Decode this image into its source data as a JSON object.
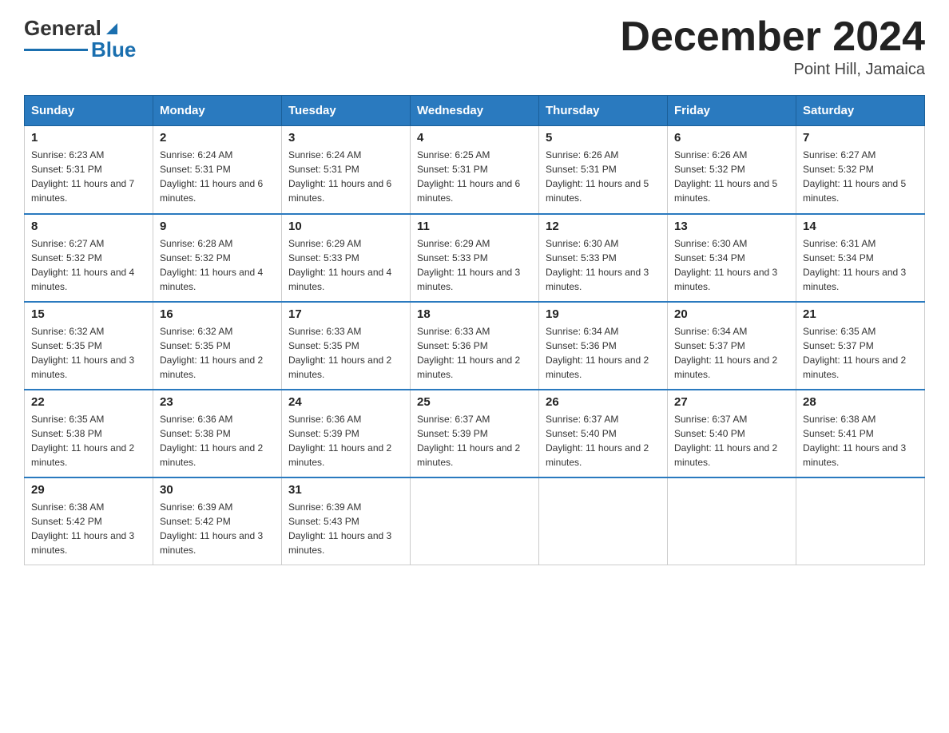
{
  "header": {
    "logo_text_black": "General",
    "logo_text_blue": "Blue",
    "month_title": "December 2024",
    "location": "Point Hill, Jamaica"
  },
  "days_of_week": [
    "Sunday",
    "Monday",
    "Tuesday",
    "Wednesday",
    "Thursday",
    "Friday",
    "Saturday"
  ],
  "weeks": [
    [
      {
        "day": "1",
        "sunrise": "6:23 AM",
        "sunset": "5:31 PM",
        "daylight": "11 hours and 7 minutes."
      },
      {
        "day": "2",
        "sunrise": "6:24 AM",
        "sunset": "5:31 PM",
        "daylight": "11 hours and 6 minutes."
      },
      {
        "day": "3",
        "sunrise": "6:24 AM",
        "sunset": "5:31 PM",
        "daylight": "11 hours and 6 minutes."
      },
      {
        "day": "4",
        "sunrise": "6:25 AM",
        "sunset": "5:31 PM",
        "daylight": "11 hours and 6 minutes."
      },
      {
        "day": "5",
        "sunrise": "6:26 AM",
        "sunset": "5:31 PM",
        "daylight": "11 hours and 5 minutes."
      },
      {
        "day": "6",
        "sunrise": "6:26 AM",
        "sunset": "5:32 PM",
        "daylight": "11 hours and 5 minutes."
      },
      {
        "day": "7",
        "sunrise": "6:27 AM",
        "sunset": "5:32 PM",
        "daylight": "11 hours and 5 minutes."
      }
    ],
    [
      {
        "day": "8",
        "sunrise": "6:27 AM",
        "sunset": "5:32 PM",
        "daylight": "11 hours and 4 minutes."
      },
      {
        "day": "9",
        "sunrise": "6:28 AM",
        "sunset": "5:32 PM",
        "daylight": "11 hours and 4 minutes."
      },
      {
        "day": "10",
        "sunrise": "6:29 AM",
        "sunset": "5:33 PM",
        "daylight": "11 hours and 4 minutes."
      },
      {
        "day": "11",
        "sunrise": "6:29 AM",
        "sunset": "5:33 PM",
        "daylight": "11 hours and 3 minutes."
      },
      {
        "day": "12",
        "sunrise": "6:30 AM",
        "sunset": "5:33 PM",
        "daylight": "11 hours and 3 minutes."
      },
      {
        "day": "13",
        "sunrise": "6:30 AM",
        "sunset": "5:34 PM",
        "daylight": "11 hours and 3 minutes."
      },
      {
        "day": "14",
        "sunrise": "6:31 AM",
        "sunset": "5:34 PM",
        "daylight": "11 hours and 3 minutes."
      }
    ],
    [
      {
        "day": "15",
        "sunrise": "6:32 AM",
        "sunset": "5:35 PM",
        "daylight": "11 hours and 3 minutes."
      },
      {
        "day": "16",
        "sunrise": "6:32 AM",
        "sunset": "5:35 PM",
        "daylight": "11 hours and 2 minutes."
      },
      {
        "day": "17",
        "sunrise": "6:33 AM",
        "sunset": "5:35 PM",
        "daylight": "11 hours and 2 minutes."
      },
      {
        "day": "18",
        "sunrise": "6:33 AM",
        "sunset": "5:36 PM",
        "daylight": "11 hours and 2 minutes."
      },
      {
        "day": "19",
        "sunrise": "6:34 AM",
        "sunset": "5:36 PM",
        "daylight": "11 hours and 2 minutes."
      },
      {
        "day": "20",
        "sunrise": "6:34 AM",
        "sunset": "5:37 PM",
        "daylight": "11 hours and 2 minutes."
      },
      {
        "day": "21",
        "sunrise": "6:35 AM",
        "sunset": "5:37 PM",
        "daylight": "11 hours and 2 minutes."
      }
    ],
    [
      {
        "day": "22",
        "sunrise": "6:35 AM",
        "sunset": "5:38 PM",
        "daylight": "11 hours and 2 minutes."
      },
      {
        "day": "23",
        "sunrise": "6:36 AM",
        "sunset": "5:38 PM",
        "daylight": "11 hours and 2 minutes."
      },
      {
        "day": "24",
        "sunrise": "6:36 AM",
        "sunset": "5:39 PM",
        "daylight": "11 hours and 2 minutes."
      },
      {
        "day": "25",
        "sunrise": "6:37 AM",
        "sunset": "5:39 PM",
        "daylight": "11 hours and 2 minutes."
      },
      {
        "day": "26",
        "sunrise": "6:37 AM",
        "sunset": "5:40 PM",
        "daylight": "11 hours and 2 minutes."
      },
      {
        "day": "27",
        "sunrise": "6:37 AM",
        "sunset": "5:40 PM",
        "daylight": "11 hours and 2 minutes."
      },
      {
        "day": "28",
        "sunrise": "6:38 AM",
        "sunset": "5:41 PM",
        "daylight": "11 hours and 3 minutes."
      }
    ],
    [
      {
        "day": "29",
        "sunrise": "6:38 AM",
        "sunset": "5:42 PM",
        "daylight": "11 hours and 3 minutes."
      },
      {
        "day": "30",
        "sunrise": "6:39 AM",
        "sunset": "5:42 PM",
        "daylight": "11 hours and 3 minutes."
      },
      {
        "day": "31",
        "sunrise": "6:39 AM",
        "sunset": "5:43 PM",
        "daylight": "11 hours and 3 minutes."
      },
      null,
      null,
      null,
      null
    ]
  ]
}
